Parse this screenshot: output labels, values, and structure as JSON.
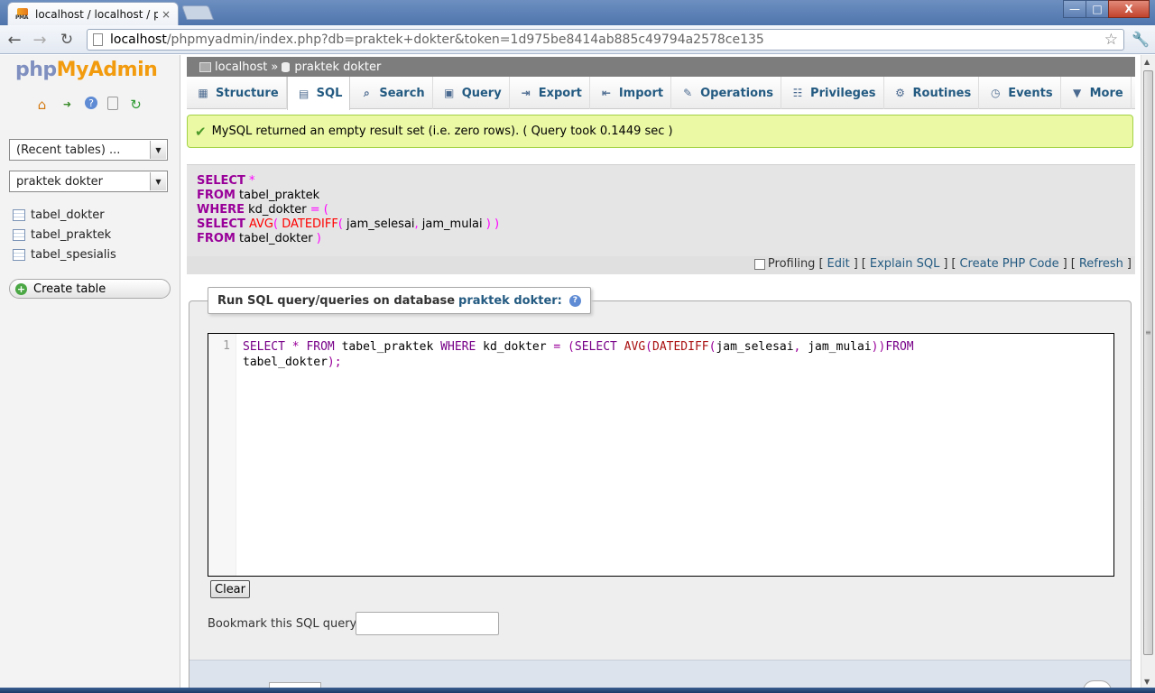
{
  "browser": {
    "tab_title": "localhost / localhost / prak",
    "tab_close": "×",
    "favicon_label": "PMA",
    "url_host": "localhost",
    "url_path": "/phpmyadmin/index.php?db=praktek+dokter&token=1d975be8414ab885c49794a2578ce135",
    "controls": {
      "minimize": "—",
      "maximize": "□",
      "close": "X"
    }
  },
  "logo": {
    "part1": "php",
    "part2": "MyAdmin"
  },
  "leftnav": {
    "recent_tables": "(Recent tables) ...",
    "database": "praktek dokter",
    "tables": [
      "tabel_dokter",
      "tabel_praktek",
      "tabel_spesialis"
    ],
    "create_table": "Create table"
  },
  "breadcrumb": {
    "server": "localhost",
    "separator": "»",
    "database": "praktek dokter"
  },
  "tabs": [
    {
      "label": "Structure",
      "icon": "structure-icon",
      "glyph": "▦"
    },
    {
      "label": "SQL",
      "icon": "sql-icon",
      "glyph": "▤"
    },
    {
      "label": "Search",
      "icon": "search-icon",
      "glyph": "⌕"
    },
    {
      "label": "Query",
      "icon": "query-icon",
      "glyph": "▣"
    },
    {
      "label": "Export",
      "icon": "export-icon",
      "glyph": "⇥"
    },
    {
      "label": "Import",
      "icon": "import-icon",
      "glyph": "⇤"
    },
    {
      "label": "Operations",
      "icon": "wrench-icon",
      "glyph": "✎"
    },
    {
      "label": "Privileges",
      "icon": "privileges-icon",
      "glyph": "☷"
    },
    {
      "label": "Routines",
      "icon": "routines-icon",
      "glyph": "⚙"
    },
    {
      "label": "Events",
      "icon": "clock-icon",
      "glyph": "◷"
    },
    {
      "label": "More",
      "icon": "chevron-down-icon",
      "glyph": "▼"
    }
  ],
  "message": "MySQL returned an empty result set (i.e. zero rows). ( Query took 0.1449 sec )",
  "formatted_sql": {
    "l1_kw": "SELECT",
    "l1_op": " *",
    "l2_kw": "FROM",
    "l2_txt": " tabel_praktek",
    "l3_kw": "WHERE",
    "l3_txt": " kd_dokter",
    "l3_op": " = (",
    "l4_kw": "SELECT",
    "l4_fn": " AVG",
    "l4_op1": "(",
    "l4_fn2": " DATEDIFF",
    "l4_op2": "(",
    "l4_txt": " jam_selesai",
    "l4_op3": ",",
    "l4_txt2": " jam_mulai",
    "l4_op4": " ) )",
    "l5_kw": "FROM",
    "l5_txt": " tabel_dokter",
    "l5_op": " )"
  },
  "sql_actions": {
    "profiling": "Profiling",
    "open": "[",
    "close": "]",
    "edit": "Edit",
    "explain": "Explain SQL",
    "php": "Create PHP Code",
    "refresh": "Refresh"
  },
  "query_box": {
    "legend_prefix": "Run SQL query/queries on database",
    "legend_db": "praktek dokter:",
    "help": "?",
    "line_number": "1",
    "code": {
      "k1": "SELECT",
      "o1": " * ",
      "k2": "FROM",
      "t1": " tabel_praktek ",
      "k3": "WHERE",
      "t2": " kd_dokter ",
      "o2": "=",
      "o3": " (",
      "k4": "SELECT",
      "f1": " AVG",
      "o4": "(",
      "f2": "DATEDIFF",
      "o5": "(",
      "t3": "jam_selesai",
      "o6": ",",
      "t4": " jam_mulai",
      "o7": "))",
      "k5": "FROM",
      "t5": "\ntabel_dokter",
      "o8": ");"
    },
    "clear_label": "Clear",
    "bookmark_label": "Bookmark this SQL query:",
    "bookmark_value": ""
  }
}
